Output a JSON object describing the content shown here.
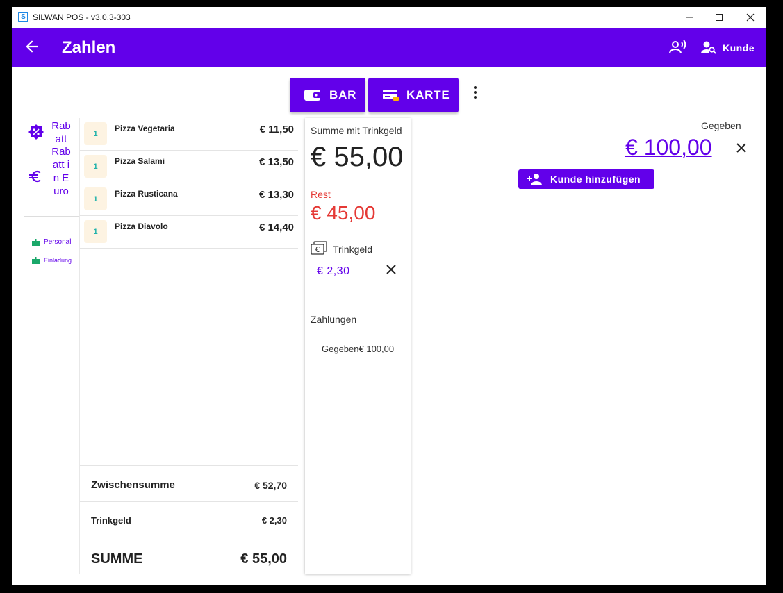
{
  "window": {
    "title": "SILWAN POS - v3.0.3-303",
    "app_icon": "S"
  },
  "appbar": {
    "title": "Zahlen",
    "kunde_label": "Kunde"
  },
  "payment": {
    "bar_label": "BAR",
    "karte_label": "KARTE"
  },
  "rail": {
    "rabatt_label": "Rabatt",
    "rabatt_euro_label": "Rabatt in Euro",
    "personal_label": "Personal",
    "einladung_label": "Einladung"
  },
  "order": {
    "items": [
      {
        "qty": "1",
        "name": "Pizza Vegetaria",
        "price": "€ 11,50"
      },
      {
        "qty": "1",
        "name": "Pizza Salami",
        "price": "€ 13,50"
      },
      {
        "qty": "1",
        "name": "Pizza Rusticana",
        "price": "€ 13,30"
      },
      {
        "qty": "1",
        "name": "Pizza Diavolo",
        "price": "€ 14,40"
      }
    ],
    "subtotal_label": "Zwischensumme",
    "subtotal_value": "€ 52,70",
    "tip_label": "Trinkgeld",
    "tip_value": "€ 2,30",
    "sum_label": "SUMME",
    "sum_value": "€ 55,00"
  },
  "summary": {
    "total_label": "Summe mit Trinkgeld",
    "total_value": "€ 55,00",
    "rest_label": "Rest",
    "rest_value": "€ 45,00",
    "tip_label": "Trinkgeld",
    "tip_value": "€ 2,30",
    "payments_label": "Zahlungen",
    "payments": [
      {
        "text": "Gegeben€ 100,00"
      }
    ]
  },
  "given": {
    "label": "Gegeben",
    "value": "€ 100,00",
    "add_customer_label": "Kunde hinzufügen"
  },
  "colors": {
    "accent": "#6200ea",
    "rest": "#e53935",
    "qty_text": "#20b2aa",
    "qty_bg": "#fdf3e2"
  }
}
